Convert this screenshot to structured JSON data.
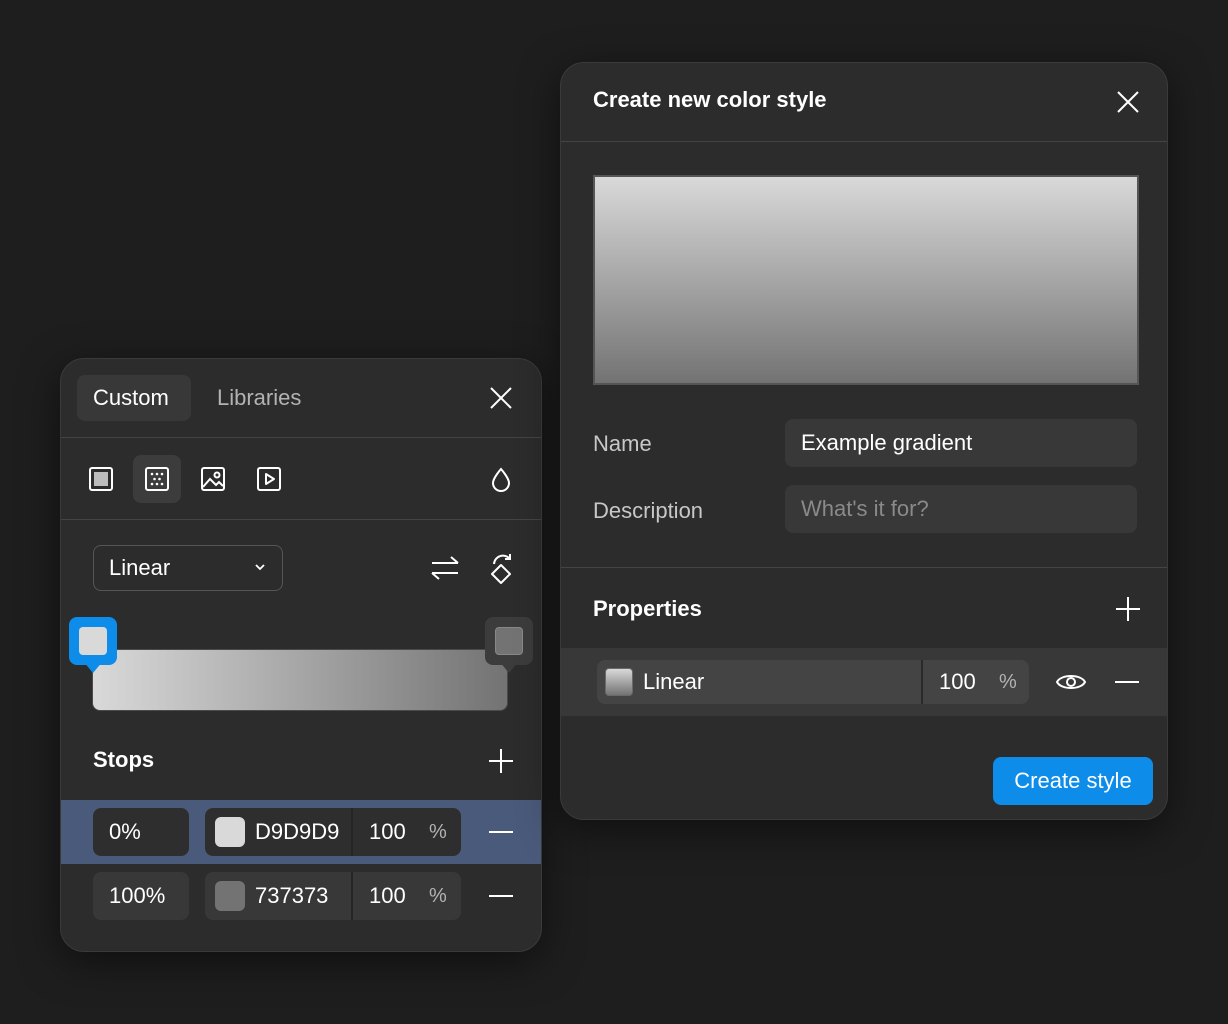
{
  "colors": {
    "accent": "#0d8ce9",
    "stop_start": "#D9D9D9",
    "stop_end": "#737373",
    "selected_row": "#4a5a7a"
  },
  "left_panel": {
    "tabs": [
      {
        "label": "Custom",
        "active": true
      },
      {
        "label": "Libraries",
        "active": false
      }
    ],
    "paint_types": [
      {
        "icon": "solid-fill-icon",
        "selected": false
      },
      {
        "icon": "gradient-fill-icon",
        "selected": true
      },
      {
        "icon": "image-fill-icon",
        "selected": false
      },
      {
        "icon": "video-fill-icon",
        "selected": false
      }
    ],
    "gradient_type": "Linear",
    "stops_title": "Stops",
    "stops": [
      {
        "position": "0%",
        "hex": "D9D9D9",
        "opacity": "100",
        "unit": "%",
        "selected": true
      },
      {
        "position": "100%",
        "hex": "737373",
        "opacity": "100",
        "unit": "%",
        "selected": false
      }
    ]
  },
  "right_panel": {
    "title": "Create new color style",
    "name_label": "Name",
    "name_value": "Example gradient",
    "description_label": "Description",
    "description_placeholder": "What's it for?",
    "properties_title": "Properties",
    "property": {
      "name": "Linear",
      "opacity": "100",
      "unit": "%"
    },
    "create_button": "Create style"
  }
}
